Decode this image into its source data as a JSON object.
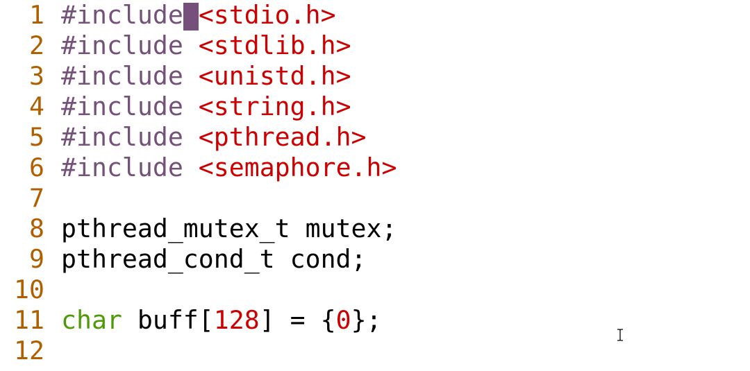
{
  "editor": {
    "lines": [
      {
        "number": "1",
        "tokens": [
          {
            "text": "#include",
            "kind": "preproc"
          },
          {
            "text": "<stdio.h>",
            "kind": "string"
          }
        ]
      },
      {
        "number": "2",
        "tokens": [
          {
            "text": "#include",
            "kind": "preproc"
          },
          {
            "text": " ",
            "kind": "plain"
          },
          {
            "text": "<stdlib.h>",
            "kind": "string"
          }
        ]
      },
      {
        "number": "3",
        "tokens": [
          {
            "text": "#include",
            "kind": "preproc"
          },
          {
            "text": " ",
            "kind": "plain"
          },
          {
            "text": "<unistd.h>",
            "kind": "string"
          }
        ]
      },
      {
        "number": "4",
        "tokens": [
          {
            "text": "#include",
            "kind": "preproc"
          },
          {
            "text": " ",
            "kind": "plain"
          },
          {
            "text": "<string.h>",
            "kind": "string"
          }
        ]
      },
      {
        "number": "5",
        "tokens": [
          {
            "text": "#include",
            "kind": "preproc"
          },
          {
            "text": " ",
            "kind": "plain"
          },
          {
            "text": "<pthread.h>",
            "kind": "string"
          }
        ]
      },
      {
        "number": "6",
        "tokens": [
          {
            "text": "#include",
            "kind": "preproc"
          },
          {
            "text": " ",
            "kind": "plain"
          },
          {
            "text": "<semaphore.h>",
            "kind": "string"
          }
        ]
      },
      {
        "number": "7",
        "tokens": []
      },
      {
        "number": "8",
        "tokens": [
          {
            "text": "pthread_mutex_t mutex;",
            "kind": "plain"
          }
        ]
      },
      {
        "number": "9",
        "tokens": [
          {
            "text": "pthread_cond_t cond;",
            "kind": "plain"
          }
        ]
      },
      {
        "number": "10",
        "tokens": []
      },
      {
        "number": "11",
        "tokens": [
          {
            "text": "char",
            "kind": "type"
          },
          {
            "text": " buff[",
            "kind": "plain"
          },
          {
            "text": "128",
            "kind": "number"
          },
          {
            "text": "] = {",
            "kind": "plain"
          },
          {
            "text": "0",
            "kind": "number"
          },
          {
            "text": "};",
            "kind": "plain"
          }
        ]
      },
      {
        "number": "12",
        "tokens": []
      }
    ],
    "cursor": {
      "line": "1",
      "after_token": "#include"
    },
    "mouse_pointer_icon": "text-ibeam-icon"
  },
  "colors": {
    "line_number": "#af5f00",
    "preproc": "#75507b",
    "string": "#cc0000",
    "type": "#4e9a06",
    "number": "#cc0000",
    "plain": "#000000",
    "cursor": "#75507b",
    "background": "#ffffff"
  }
}
